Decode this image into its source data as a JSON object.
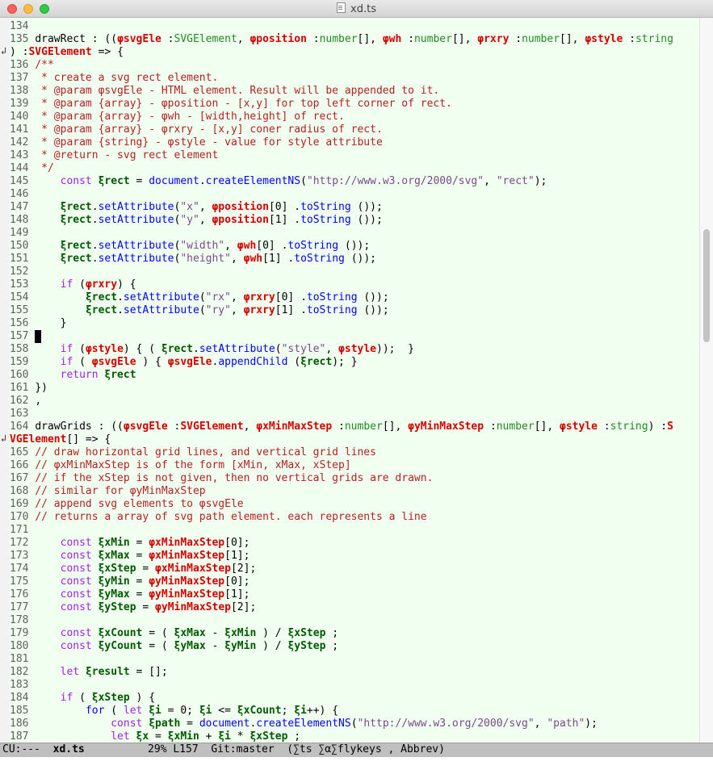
{
  "window": {
    "title": "xd.ts"
  },
  "modeline": {
    "state": "CU:---",
    "buffer": "xd.ts",
    "position": "29% L157",
    "git": "Git:master",
    "modes": "(∑ts ∑α∑flykeys , Abbrev)"
  },
  "colors": {
    "comment": "#b22222",
    "string": "#7a4a8a",
    "keyword": "#a020f0",
    "function": "#0000ff",
    "type": "#228b22",
    "param_var": "#d40000",
    "local_var": "#005a00",
    "editor_bg": "#f0fff0"
  },
  "icons": {
    "wrap_indicator": "line-continuation-arrow-icon",
    "file": "document-icon"
  },
  "editor": {
    "lines": [
      [
        [
          "ln",
          "134 "
        ]
      ],
      [
        [
          "ln",
          "135 "
        ],
        [
          "",
          "drawRect : (("
        ],
        [
          "pvar",
          "φsvgEle"
        ],
        [
          "",
          " :"
        ],
        [
          "ty",
          "SVGElement"
        ],
        [
          "",
          ", "
        ],
        [
          "pvar",
          "φposition"
        ],
        [
          "",
          " :"
        ],
        [
          "ty",
          "number"
        ],
        [
          "",
          "[], "
        ],
        [
          "pvar",
          "φwh"
        ],
        [
          "",
          " :"
        ],
        [
          "ty",
          "number"
        ],
        [
          "",
          "[], "
        ],
        [
          "pvar",
          "φrxry"
        ],
        [
          "",
          " :"
        ],
        [
          "ty",
          "number"
        ],
        [
          "",
          "[], "
        ],
        [
          "pvar",
          "φstyle"
        ],
        [
          "",
          " :"
        ],
        [
          "ty",
          "string"
        ]
      ],
      [
        [
          "",
          ") :"
        ],
        [
          "pvar",
          "SVGElement"
        ],
        [
          "",
          " => {"
        ]
      ],
      [
        [
          "ln",
          "136 "
        ],
        [
          "cm",
          "/**"
        ]
      ],
      [
        [
          "ln",
          "137 "
        ],
        [
          "cm",
          " * create a svg rect element."
        ]
      ],
      [
        [
          "ln",
          "138 "
        ],
        [
          "cm",
          " * @param φsvgEle - HTML element. Result will be appended to it."
        ]
      ],
      [
        [
          "ln",
          "139 "
        ],
        [
          "cm",
          " * @param {array} - φposition - [x,y] for top left corner of rect."
        ]
      ],
      [
        [
          "ln",
          "140 "
        ],
        [
          "cm",
          " * @param {array} - φwh - [width,height] of rect."
        ]
      ],
      [
        [
          "ln",
          "141 "
        ],
        [
          "cm",
          " * @param {array} - φrxry - [x,y] coner radius of rect."
        ]
      ],
      [
        [
          "ln",
          "142 "
        ],
        [
          "cm",
          " * @param {string} - φstyle - value for style attribute"
        ]
      ],
      [
        [
          "ln",
          "143 "
        ],
        [
          "cm",
          " * @return - svg rect element"
        ]
      ],
      [
        [
          "ln",
          "144 "
        ],
        [
          "cm",
          " */"
        ]
      ],
      [
        [
          "ln",
          "145 "
        ],
        [
          "kw",
          "    const "
        ],
        [
          "lvar",
          "ξrect"
        ],
        [
          "",
          " = "
        ],
        [
          "fn",
          "document"
        ],
        [
          "",
          "."
        ],
        [
          "fn",
          "createElementNS"
        ],
        [
          "",
          "("
        ],
        [
          "str",
          "\"http://www.w3.org/2000/svg\""
        ],
        [
          "",
          ", "
        ],
        [
          "str",
          "\"rect\""
        ],
        [
          "",
          ");"
        ]
      ],
      [
        [
          "ln",
          "146 "
        ]
      ],
      [
        [
          "ln",
          "147 "
        ],
        [
          "",
          "    "
        ],
        [
          "lvar",
          "ξrect"
        ],
        [
          "",
          "."
        ],
        [
          "fn",
          "setAttribute"
        ],
        [
          "",
          "("
        ],
        [
          "str",
          "\"x\""
        ],
        [
          "",
          ", "
        ],
        [
          "pvar",
          "φposition"
        ],
        [
          "",
          "[0] ."
        ],
        [
          "fn",
          "toString"
        ],
        [
          "",
          " ());"
        ]
      ],
      [
        [
          "ln",
          "148 "
        ],
        [
          "",
          "    "
        ],
        [
          "lvar",
          "ξrect"
        ],
        [
          "",
          "."
        ],
        [
          "fn",
          "setAttribute"
        ],
        [
          "",
          "("
        ],
        [
          "str",
          "\"y\""
        ],
        [
          "",
          ", "
        ],
        [
          "pvar",
          "φposition"
        ],
        [
          "",
          "[1] ."
        ],
        [
          "fn",
          "toString"
        ],
        [
          "",
          " ());"
        ]
      ],
      [
        [
          "ln",
          "149 "
        ]
      ],
      [
        [
          "ln",
          "150 "
        ],
        [
          "",
          "    "
        ],
        [
          "lvar",
          "ξrect"
        ],
        [
          "",
          "."
        ],
        [
          "fn",
          "setAttribute"
        ],
        [
          "",
          "("
        ],
        [
          "str",
          "\"width\""
        ],
        [
          "",
          ", "
        ],
        [
          "pvar",
          "φwh"
        ],
        [
          "",
          "[0] ."
        ],
        [
          "fn",
          "toString"
        ],
        [
          "",
          " ());"
        ]
      ],
      [
        [
          "ln",
          "151 "
        ],
        [
          "",
          "    "
        ],
        [
          "lvar",
          "ξrect"
        ],
        [
          "",
          "."
        ],
        [
          "fn",
          "setAttribute"
        ],
        [
          "",
          "("
        ],
        [
          "str",
          "\"height\""
        ],
        [
          "",
          ", "
        ],
        [
          "pvar",
          "φwh"
        ],
        [
          "",
          "[1] ."
        ],
        [
          "fn",
          "toString"
        ],
        [
          "",
          " ());"
        ]
      ],
      [
        [
          "ln",
          "152 "
        ]
      ],
      [
        [
          "ln",
          "153 "
        ],
        [
          "kw",
          "    if "
        ],
        [
          "",
          "("
        ],
        [
          "pvar",
          "φrxry"
        ],
        [
          "",
          ") {"
        ]
      ],
      [
        [
          "ln",
          "154 "
        ],
        [
          "",
          "        "
        ],
        [
          "lvar",
          "ξrect"
        ],
        [
          "",
          "."
        ],
        [
          "fn",
          "setAttribute"
        ],
        [
          "",
          "("
        ],
        [
          "str",
          "\"rx\""
        ],
        [
          "",
          ", "
        ],
        [
          "pvar",
          "φrxry"
        ],
        [
          "",
          "[0] ."
        ],
        [
          "fn",
          "toString"
        ],
        [
          "",
          " ());"
        ]
      ],
      [
        [
          "ln",
          "155 "
        ],
        [
          "",
          "        "
        ],
        [
          "lvar",
          "ξrect"
        ],
        [
          "",
          "."
        ],
        [
          "fn",
          "setAttribute"
        ],
        [
          "",
          "("
        ],
        [
          "str",
          "\"ry\""
        ],
        [
          "",
          ", "
        ],
        [
          "pvar",
          "φrxry"
        ],
        [
          "",
          "[1] ."
        ],
        [
          "fn",
          "toString"
        ],
        [
          "",
          " ());"
        ]
      ],
      [
        [
          "ln",
          "156 "
        ],
        [
          "",
          "    }"
        ]
      ],
      [
        [
          "ln",
          "157 "
        ],
        [
          "cursor",
          " "
        ]
      ],
      [
        [
          "ln",
          "158 "
        ],
        [
          "kw",
          "    if "
        ],
        [
          "",
          "("
        ],
        [
          "pvar",
          "φstyle"
        ],
        [
          "",
          ") { ( "
        ],
        [
          "lvar",
          "ξrect"
        ],
        [
          "",
          "."
        ],
        [
          "fn",
          "setAttribute"
        ],
        [
          "",
          "("
        ],
        [
          "str",
          "\"style\""
        ],
        [
          "",
          ", "
        ],
        [
          "pvar",
          "φstyle"
        ],
        [
          "",
          "));  }"
        ]
      ],
      [
        [
          "ln",
          "159 "
        ],
        [
          "kw",
          "    if "
        ],
        [
          "",
          "( "
        ],
        [
          "pvar",
          "φsvgEle"
        ],
        [
          "",
          " ) { "
        ],
        [
          "pvar",
          "φsvgEle"
        ],
        [
          "",
          "."
        ],
        [
          "fn",
          "appendChild"
        ],
        [
          "",
          " ("
        ],
        [
          "lvar",
          "ξrect"
        ],
        [
          "",
          "); }"
        ]
      ],
      [
        [
          "ln",
          "160 "
        ],
        [
          "kw",
          "    return "
        ],
        [
          "lvar",
          "ξrect"
        ]
      ],
      [
        [
          "ln",
          "161 "
        ],
        [
          "",
          "})"
        ]
      ],
      [
        [
          "ln",
          "162 "
        ],
        [
          "",
          ","
        ]
      ],
      [
        [
          "ln",
          "163 "
        ]
      ],
      [
        [
          "ln",
          "164 "
        ],
        [
          "",
          "drawGrids : (("
        ],
        [
          "pvar",
          "φsvgEle"
        ],
        [
          "",
          " :"
        ],
        [
          "pvar",
          "SVGElement"
        ],
        [
          "",
          ", "
        ],
        [
          "pvar",
          "φxMinMaxStep"
        ],
        [
          "",
          " :"
        ],
        [
          "ty",
          "number"
        ],
        [
          "",
          "[], "
        ],
        [
          "pvar",
          "φyMinMaxStep"
        ],
        [
          "",
          " :"
        ],
        [
          "ty",
          "number"
        ],
        [
          "",
          "[], "
        ],
        [
          "pvar",
          "φstyle"
        ],
        [
          "",
          " :"
        ],
        [
          "ty",
          "string"
        ],
        [
          "",
          ") :"
        ],
        [
          "pvar",
          "S"
        ]
      ],
      [
        [
          "pvar",
          "VGElement"
        ],
        [
          "",
          "[] => {"
        ]
      ],
      [
        [
          "ln",
          "165 "
        ],
        [
          "cm",
          "// draw horizontal grid lines, and vertical grid lines"
        ]
      ],
      [
        [
          "ln",
          "166 "
        ],
        [
          "cm",
          "// φxMinMaxStep is of the form [xMin, xMax, xStep]"
        ]
      ],
      [
        [
          "ln",
          "167 "
        ],
        [
          "cm",
          "// if the xStep is not given, then no vertical grids are drawn."
        ]
      ],
      [
        [
          "ln",
          "168 "
        ],
        [
          "cm",
          "// similar for φyMinMaxStep"
        ]
      ],
      [
        [
          "ln",
          "169 "
        ],
        [
          "cm",
          "// append svg elements to φsvgEle"
        ]
      ],
      [
        [
          "ln",
          "170 "
        ],
        [
          "cm",
          "// returns a array of svg path element. each represents a line"
        ]
      ],
      [
        [
          "ln",
          "171 "
        ]
      ],
      [
        [
          "ln",
          "172 "
        ],
        [
          "kw",
          "    const "
        ],
        [
          "lvar",
          "ξxMin"
        ],
        [
          "",
          " = "
        ],
        [
          "pvar",
          "φxMinMaxStep"
        ],
        [
          "",
          "[0];"
        ]
      ],
      [
        [
          "ln",
          "173 "
        ],
        [
          "kw",
          "    const "
        ],
        [
          "lvar",
          "ξxMax"
        ],
        [
          "",
          " = "
        ],
        [
          "pvar",
          "φxMinMaxStep"
        ],
        [
          "",
          "[1];"
        ]
      ],
      [
        [
          "ln",
          "174 "
        ],
        [
          "kw",
          "    const "
        ],
        [
          "lvar",
          "ξxStep"
        ],
        [
          "",
          " = "
        ],
        [
          "pvar",
          "φxMinMaxStep"
        ],
        [
          "",
          "[2];"
        ]
      ],
      [
        [
          "ln",
          "175 "
        ],
        [
          "kw",
          "    const "
        ],
        [
          "lvar",
          "ξyMin"
        ],
        [
          "",
          " = "
        ],
        [
          "pvar",
          "φyMinMaxStep"
        ],
        [
          "",
          "[0];"
        ]
      ],
      [
        [
          "ln",
          "176 "
        ],
        [
          "kw",
          "    const "
        ],
        [
          "lvar",
          "ξyMax"
        ],
        [
          "",
          " = "
        ],
        [
          "pvar",
          "φyMinMaxStep"
        ],
        [
          "",
          "[1];"
        ]
      ],
      [
        [
          "ln",
          "177 "
        ],
        [
          "kw",
          "    const "
        ],
        [
          "lvar",
          "ξyStep"
        ],
        [
          "",
          " = "
        ],
        [
          "pvar",
          "φyMinMaxStep"
        ],
        [
          "",
          "[2];"
        ]
      ],
      [
        [
          "ln",
          "178 "
        ]
      ],
      [
        [
          "ln",
          "179 "
        ],
        [
          "kw",
          "    const "
        ],
        [
          "lvar",
          "ξxCount"
        ],
        [
          "",
          " = ( "
        ],
        [
          "lvar",
          "ξxMax"
        ],
        [
          "",
          " - "
        ],
        [
          "lvar",
          "ξxMin"
        ],
        [
          "",
          " ) / "
        ],
        [
          "lvar",
          "ξxStep"
        ],
        [
          "",
          " ;"
        ]
      ],
      [
        [
          "ln",
          "180 "
        ],
        [
          "kw",
          "    const "
        ],
        [
          "lvar",
          "ξyCount"
        ],
        [
          "",
          " = ( "
        ],
        [
          "lvar",
          "ξyMax"
        ],
        [
          "",
          " - "
        ],
        [
          "lvar",
          "ξyMin"
        ],
        [
          "",
          " ) / "
        ],
        [
          "lvar",
          "ξyStep"
        ],
        [
          "",
          " ;"
        ]
      ],
      [
        [
          "ln",
          "181 "
        ]
      ],
      [
        [
          "ln",
          "182 "
        ],
        [
          "kw",
          "    let "
        ],
        [
          "lvar",
          "ξresult"
        ],
        [
          "",
          " = [];"
        ]
      ],
      [
        [
          "ln",
          "183 "
        ]
      ],
      [
        [
          "ln",
          "184 "
        ],
        [
          "kw",
          "    if "
        ],
        [
          "",
          "( "
        ],
        [
          "lvar",
          "ξxStep"
        ],
        [
          "",
          " ) {"
        ]
      ],
      [
        [
          "ln",
          "185 "
        ],
        [
          "fn",
          "        for "
        ],
        [
          "",
          "( "
        ],
        [
          "kw",
          "let "
        ],
        [
          "lvar",
          "ξi"
        ],
        [
          "",
          " = 0; "
        ],
        [
          "lvar",
          "ξi"
        ],
        [
          "",
          " <= "
        ],
        [
          "lvar",
          "ξxCount"
        ],
        [
          "",
          "; "
        ],
        [
          "lvar",
          "ξi"
        ],
        [
          "",
          "++) {"
        ]
      ],
      [
        [
          "ln",
          "186 "
        ],
        [
          "kw",
          "            const "
        ],
        [
          "lvar",
          "ξpath"
        ],
        [
          "",
          " = "
        ],
        [
          "fn",
          "document"
        ],
        [
          "",
          "."
        ],
        [
          "fn",
          "createElementNS"
        ],
        [
          "",
          "("
        ],
        [
          "str",
          "\"http://www.w3.org/2000/svg\""
        ],
        [
          "",
          ", "
        ],
        [
          "str",
          "\"path\""
        ],
        [
          "",
          ");"
        ]
      ],
      [
        [
          "ln",
          "187 "
        ],
        [
          "kw",
          "            let "
        ],
        [
          "lvar",
          "ξx"
        ],
        [
          "",
          " = "
        ],
        [
          "lvar",
          "ξxMin"
        ],
        [
          "",
          " + "
        ],
        [
          "lvar",
          "ξi"
        ],
        [
          "",
          " * "
        ],
        [
          "lvar",
          "ξxStep"
        ],
        [
          "",
          " ;"
        ]
      ]
    ]
  }
}
